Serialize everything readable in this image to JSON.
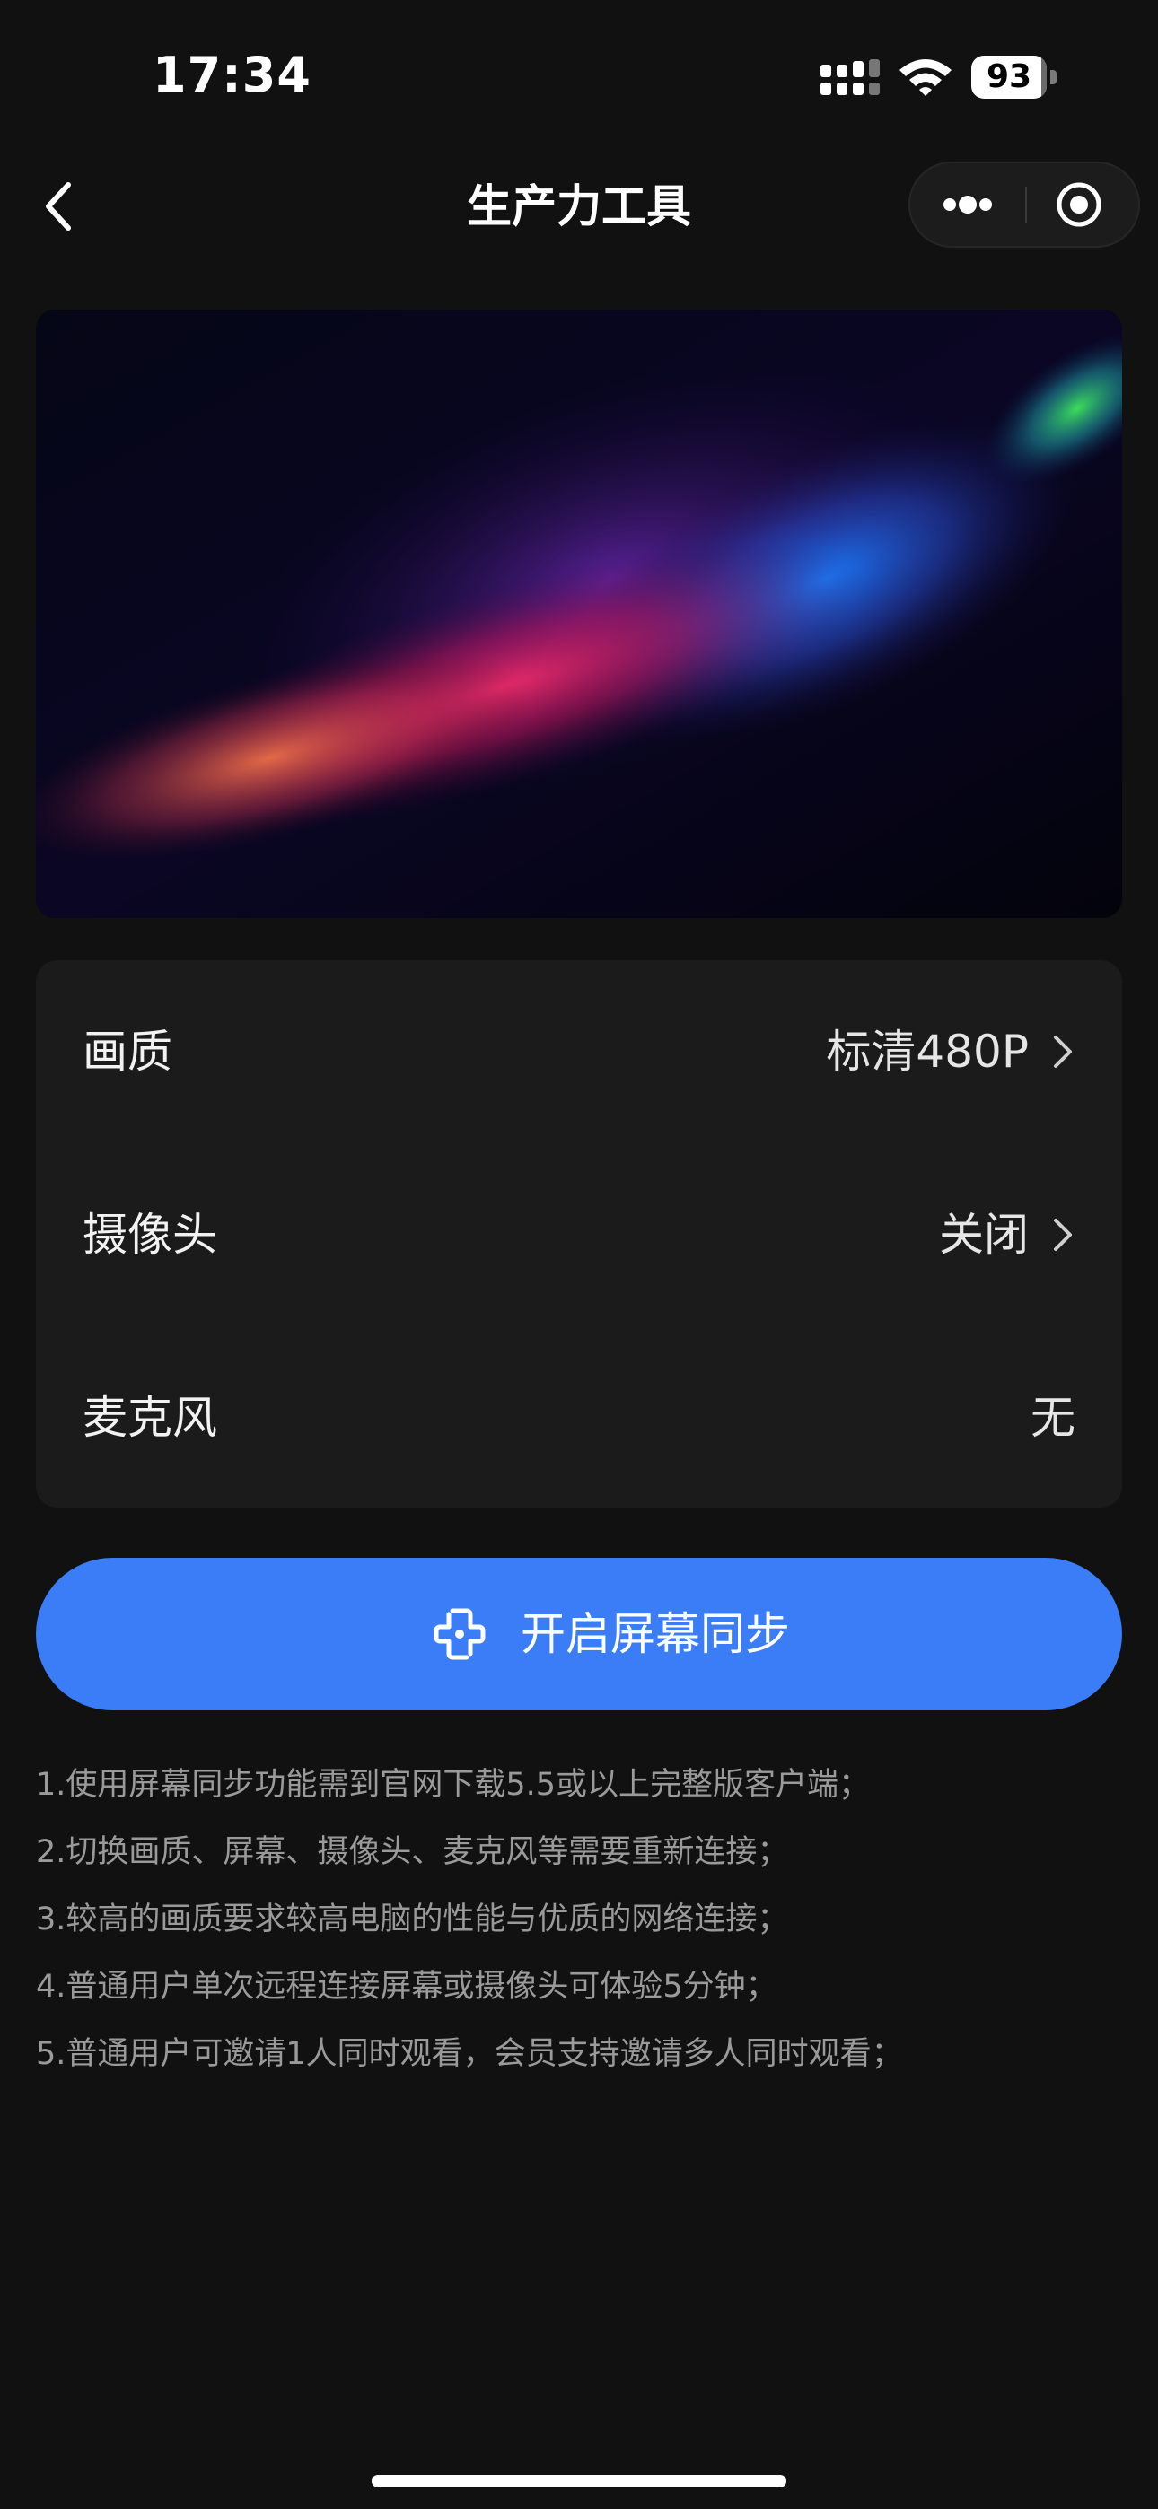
{
  "status_bar": {
    "time": "17:34",
    "battery_level": "93",
    "icons": [
      "signal-icon",
      "wifi-icon",
      "battery-icon"
    ]
  },
  "nav": {
    "title": "生产力工具",
    "icons": [
      "back-icon",
      "more-icon",
      "close-mini-program-icon"
    ]
  },
  "settings": {
    "rows": [
      {
        "label": "画质",
        "value": "标清480P",
        "has_arrow": true
      },
      {
        "label": "摄像头",
        "value": "关闭",
        "has_arrow": true
      },
      {
        "label": "麦克风",
        "value": "无",
        "has_arrow": false
      }
    ]
  },
  "start_button": {
    "label": "开启屏幕同步",
    "icon": "screen-sync-icon",
    "color": "#3a7df7"
  },
  "notes": [
    "1.使用屏幕同步功能需到官网下载5.5或以上完整版客户端；",
    "2.切换画质、屏幕、摄像头、麦克风等需要重新连接；",
    "3.较高的画质要求较高电脑的性能与优质的网络连接；",
    "4.普通用户单次远程连接屏幕或摄像头可体验5分钟；",
    "5.普通用户可邀请1人同时观看，会员支持邀请多人同时观看；"
  ],
  "colors": {
    "background": "#111111",
    "card": "#1b1b1b",
    "accent": "#3a7df7",
    "note_text": "#9a9a9a"
  }
}
